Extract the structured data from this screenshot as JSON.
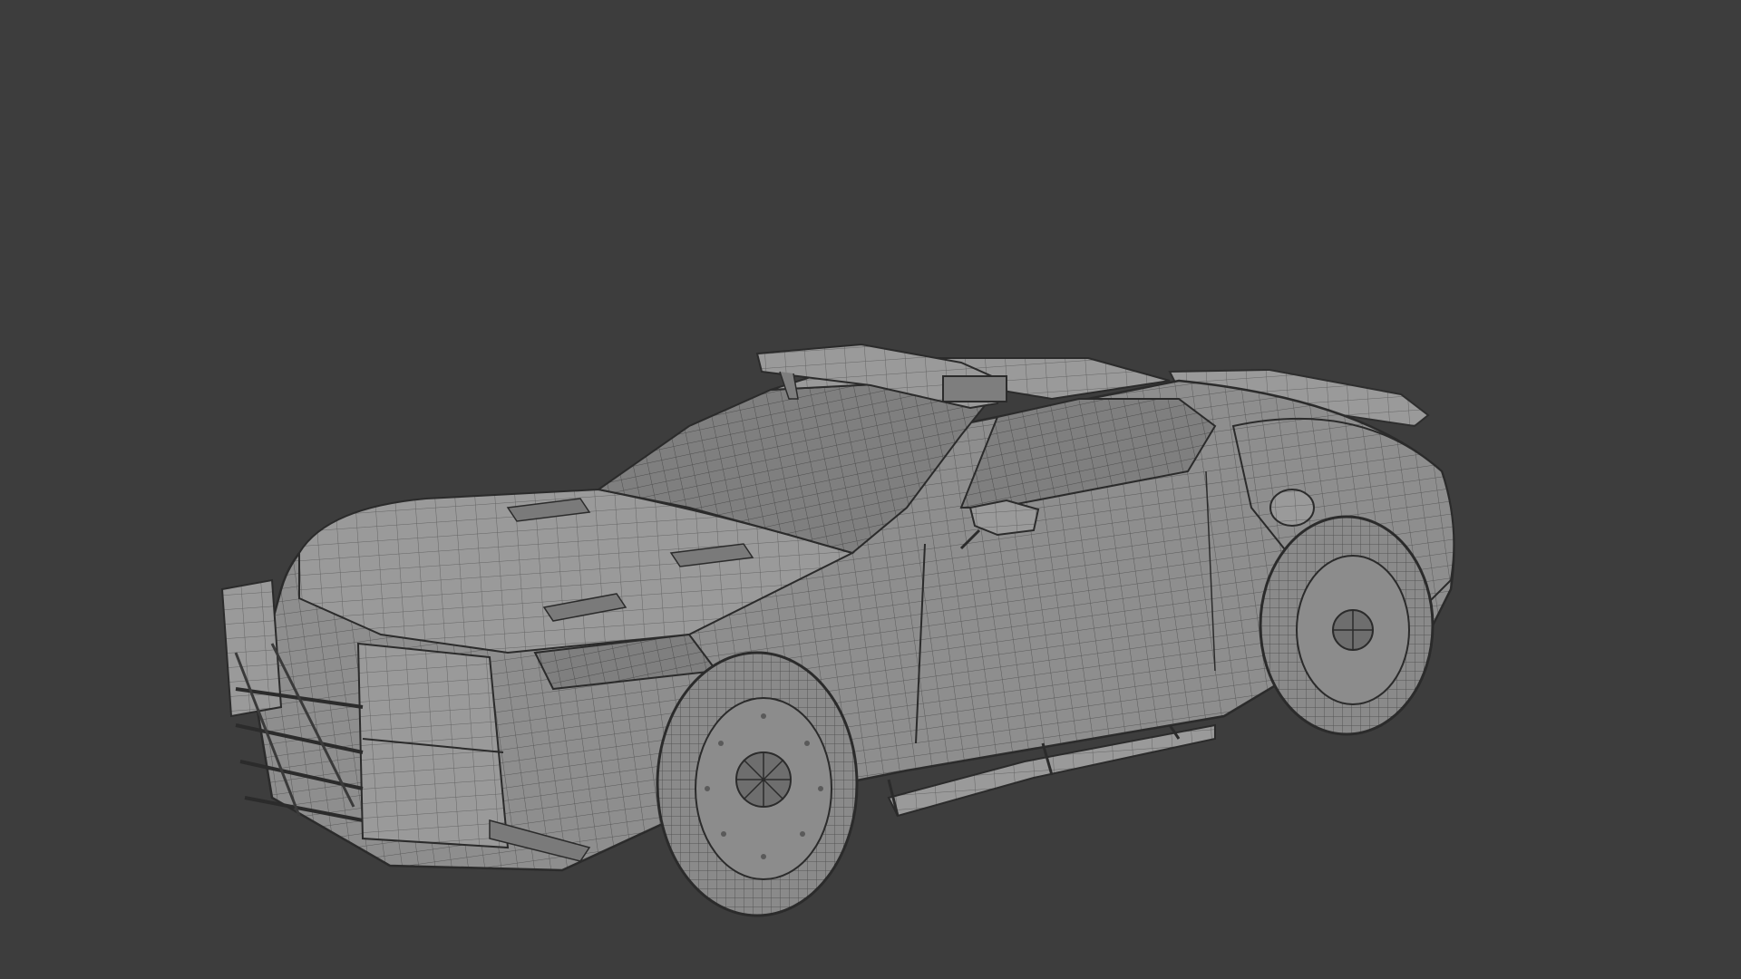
{
  "viewport": {
    "background_color": "#3d3d3d",
    "model_color": "#8d8d8d",
    "wire_color": "#4a4a4a",
    "edge_color": "#2b2b2b",
    "highlight_color": "#a6a6a6"
  },
  "model": {
    "subject": "police-muscle-car-wireframe",
    "render_mode": "solid-with-wireframe",
    "parts": [
      {
        "name": "car-body"
      },
      {
        "name": "roof-light-bar"
      },
      {
        "name": "rear-spoiler"
      },
      {
        "name": "push-bumper-guard"
      },
      {
        "name": "side-step-rail"
      },
      {
        "name": "front-wheel"
      },
      {
        "name": "rear-wheel"
      },
      {
        "name": "side-mirror"
      }
    ]
  }
}
